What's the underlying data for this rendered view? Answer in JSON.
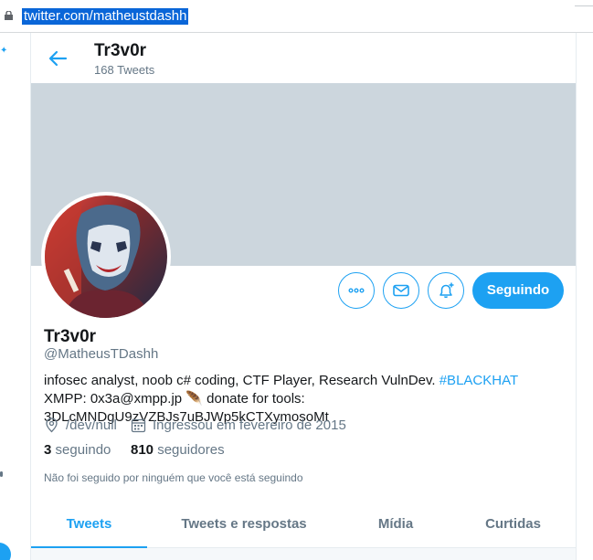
{
  "browser": {
    "url": "twitter.com/matheustdashh"
  },
  "header": {
    "name": "Tr3v0r",
    "tweet_count": "168 Tweets"
  },
  "actions": {
    "follow_label": "Seguindo"
  },
  "profile": {
    "name": "Tr3v0r",
    "handle": "@MatheusTDashh",
    "bio_text_1": "infosec analyst, noob c# coding, CTF Player, Research VulnDev. ",
    "bio_hashtag": "#BLACKHAT",
    "bio_text_2": " XMPP: 0x3a@xmpp.jp 🪶 donate for tools: 3DLcMNDgU9zVZBJs7uBJWp5kCTXymosoMt",
    "location": "/dev/null",
    "joined": "Ingressou em fevereiro de 2015",
    "following_count": "3",
    "following_label": "seguindo",
    "followers_count": "810",
    "followers_label": "seguidores",
    "followed_by": "Não foi seguido por ninguém que você está seguindo"
  },
  "tabs": [
    {
      "label": "Tweets"
    },
    {
      "label": "Tweets e respostas"
    },
    {
      "label": "Mídia"
    },
    {
      "label": "Curtidas"
    }
  ],
  "colors": {
    "accent": "#1da1f2",
    "banner": "#ccd6dd",
    "secondary_text": "#657786"
  }
}
